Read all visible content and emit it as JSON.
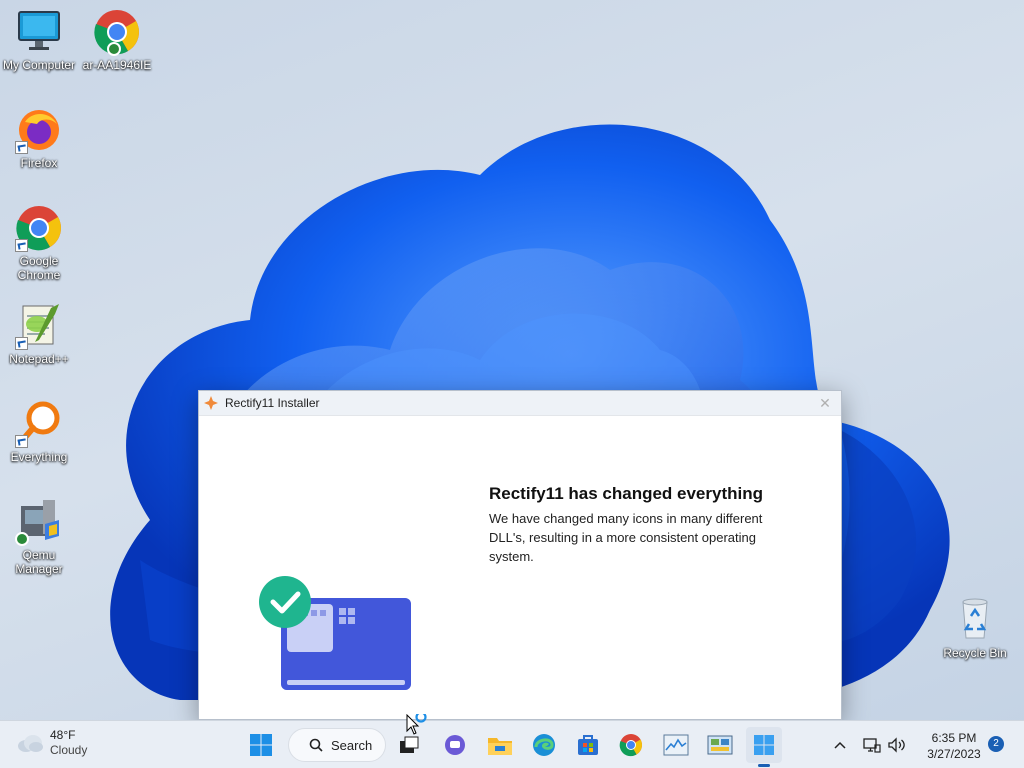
{
  "desktop": {
    "icons": [
      {
        "label": "My Computer"
      },
      {
        "label": "ar-AA1946IE"
      },
      {
        "label": "Firefox"
      },
      {
        "label": "Google Chrome"
      },
      {
        "label": "Notepad++"
      },
      {
        "label": "Everything"
      },
      {
        "label": "Qemu Manager"
      },
      {
        "label": "Recycle Bin"
      }
    ]
  },
  "installer": {
    "title": "Rectify11 Installer",
    "heading": "Rectify11 has changed everything",
    "description": "We have changed many icons in many different DLL's, resulting in a more consistent operating system.",
    "close_icon": "close-icon"
  },
  "taskbar": {
    "weather_temp": "48°F",
    "weather_cond": "Cloudy",
    "search_label": "Search",
    "time": "6:35 PM",
    "date": "3/27/2023",
    "notification_count": "2"
  },
  "colors": {
    "accent": "#1a5fb4",
    "check_green": "#1fb58f",
    "card_blue": "#3f55d9"
  }
}
